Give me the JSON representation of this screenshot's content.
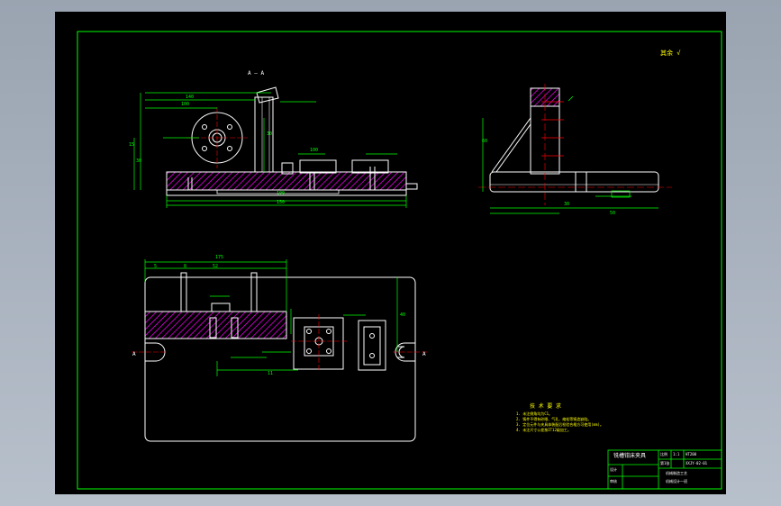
{
  "colors": {
    "background": "#000000",
    "frame": "#00ff00",
    "outline": "#ffffff",
    "dimension": "#00ff00",
    "hatch": "#ff00ff",
    "centerline": "#ff0000",
    "notes": "#ffff00",
    "title_text": "#ffffff"
  },
  "top_right_mark": "其余 √",
  "section_label": "A — A",
  "front_dims": [
    "140",
    "100",
    "30",
    "15",
    "30",
    "100",
    "150",
    "100"
  ],
  "side_dims": [
    "60",
    "30",
    "50"
  ],
  "plan_dims": [
    "175",
    "5",
    "8",
    "52",
    "A",
    "A",
    "11",
    "40"
  ],
  "notes": {
    "title": "技 术 要 求",
    "items": [
      "1. 未注倒角均为C1。",
      "2. 铸件不得有砂眼、气孔、缩松等铸造缺陷。",
      "3. 定位元件与夹具体装配后检验合格方可使用(mm)。",
      "4. 未注尺寸公差按IT12级加工。"
    ]
  },
  "title_block": {
    "name": "铣槽钳床夹具",
    "scale_label": "比例",
    "scale": "1:1",
    "sheet": "第1张",
    "doc_no": "XXJY-02-01",
    "drawn": "设计",
    "checked": "审核",
    "school": "机械制造工艺",
    "class": "机械设计一班",
    "material": "HT200"
  }
}
